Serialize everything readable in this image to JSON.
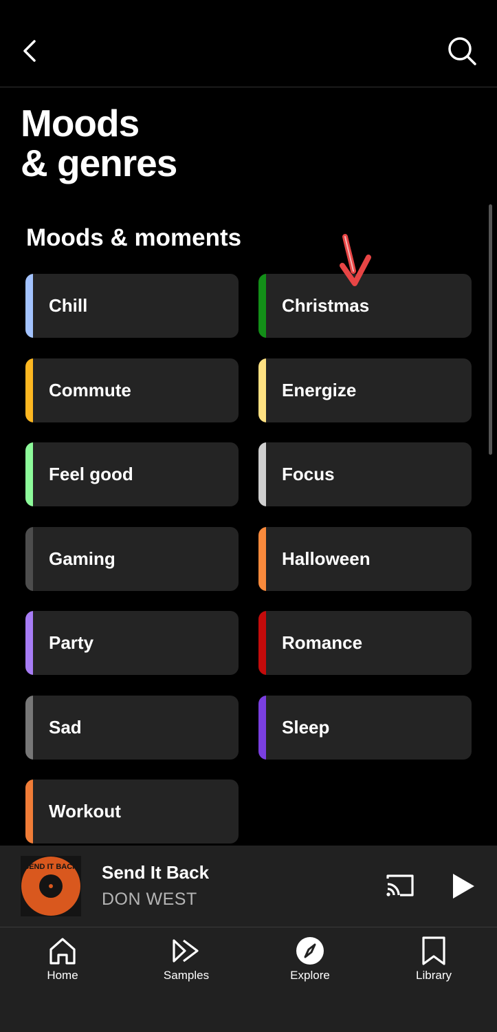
{
  "header": {
    "back_icon": "chevron-left-icon",
    "search_icon": "search-icon"
  },
  "page": {
    "title": "Moods\n& genres",
    "section_title": "Moods & moments"
  },
  "tiles": [
    {
      "label": "Chill",
      "color": "#a3c3ff"
    },
    {
      "label": "Christmas",
      "color": "#138f18"
    },
    {
      "label": "Commute",
      "color": "#fcb721"
    },
    {
      "label": "Energize",
      "color": "#fee182"
    },
    {
      "label": "Feel good",
      "color": "#8dfa9a"
    },
    {
      "label": "Focus",
      "color": "#cfcfcf"
    },
    {
      "label": "Gaming",
      "color": "#4d4d4d"
    },
    {
      "label": "Halloween",
      "color": "#fa8a3c"
    },
    {
      "label": "Party",
      "color": "#a77cf5"
    },
    {
      "label": "Romance",
      "color": "#c40b0b"
    },
    {
      "label": "Sad",
      "color": "#777777"
    },
    {
      "label": "Sleep",
      "color": "#7a3fe0"
    },
    {
      "label": "Workout",
      "color": "#f07c37"
    }
  ],
  "now_playing": {
    "title": "Send It Back",
    "artist": "DON WEST",
    "album_art_text": "SEND IT BACK",
    "cast_icon": "cast-icon",
    "play_icon": "play-icon"
  },
  "nav": [
    {
      "label": "Home",
      "icon": "home-icon"
    },
    {
      "label": "Samples",
      "icon": "samples-icon"
    },
    {
      "label": "Explore",
      "icon": "explore-icon"
    },
    {
      "label": "Library",
      "icon": "library-icon"
    }
  ],
  "colors": {
    "background": "#000000",
    "tile_background": "#242424",
    "pointer": "#e84545"
  }
}
